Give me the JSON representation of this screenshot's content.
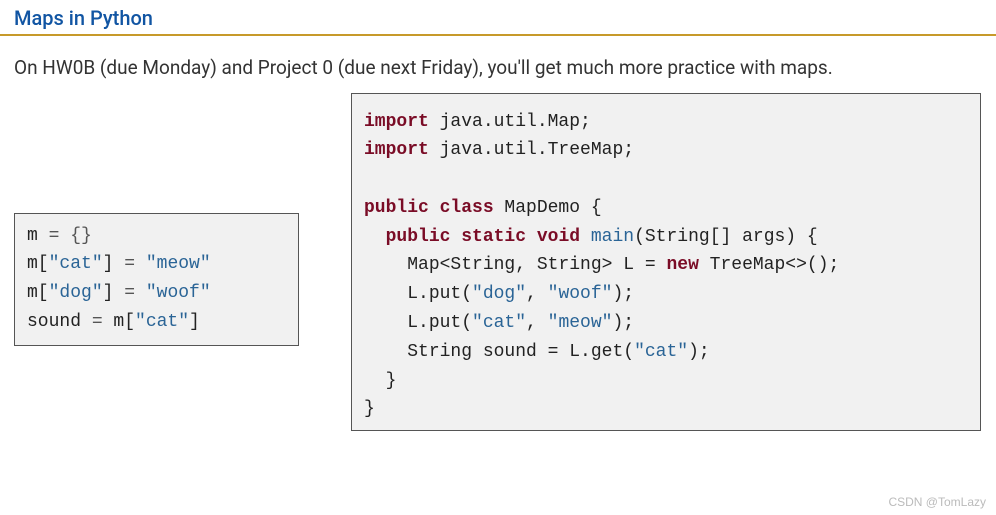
{
  "header": {
    "title": "Maps in Python"
  },
  "intro": {
    "text": "On HW0B (due Monday) and Project 0 (due next Friday), you'll get much more practice with maps."
  },
  "python_code": {
    "l1_a": "m ",
    "l1_b": "= {}",
    "l2_a": "m[",
    "l2_b": "\"cat\"",
    "l2_c": "] ",
    "l2_d": "= ",
    "l2_e": "\"meow\"",
    "l3_a": "m[",
    "l3_b": "\"dog\"",
    "l3_c": "] ",
    "l3_d": "= ",
    "l3_e": "\"woof\"",
    "l4_a": "sound ",
    "l4_b": "= ",
    "l4_c": "m[",
    "l4_d": "\"cat\"",
    "l4_e": "]"
  },
  "java_code": {
    "l1_kw": "import",
    "l1_rest": " java.util.Map;",
    "l2_kw": "import",
    "l2_rest": " java.util.TreeMap;",
    "l3": "",
    "l4_kw1": "public",
    "l4_kw2": " class",
    "l4_rest": " MapDemo {",
    "l5_pad": "  ",
    "l5_kw1": "public",
    "l5_kw2": " static",
    "l5_kw3": " void",
    "l5_fn": " main",
    "l5_rest": "(String[] args) {",
    "l6_pad": "    ",
    "l6_a": "Map<String, String> L = ",
    "l6_kw": "new",
    "l6_b": " TreeMap<>();",
    "l7_pad": "    ",
    "l7_a": "L.put(",
    "l7_s1": "\"dog\"",
    "l7_b": ", ",
    "l7_s2": "\"woof\"",
    "l7_c": ");",
    "l8_pad": "    ",
    "l8_a": "L.put(",
    "l8_s1": "\"cat\"",
    "l8_b": ", ",
    "l8_s2": "\"meow\"",
    "l8_c": ");",
    "l9_pad": "    ",
    "l9_a": "String sound = L.get(",
    "l9_s1": "\"cat\"",
    "l9_b": ");",
    "l10_pad": "  ",
    "l10_a": "}",
    "l11_a": "}"
  },
  "watermark": "CSDN @TomLazy"
}
